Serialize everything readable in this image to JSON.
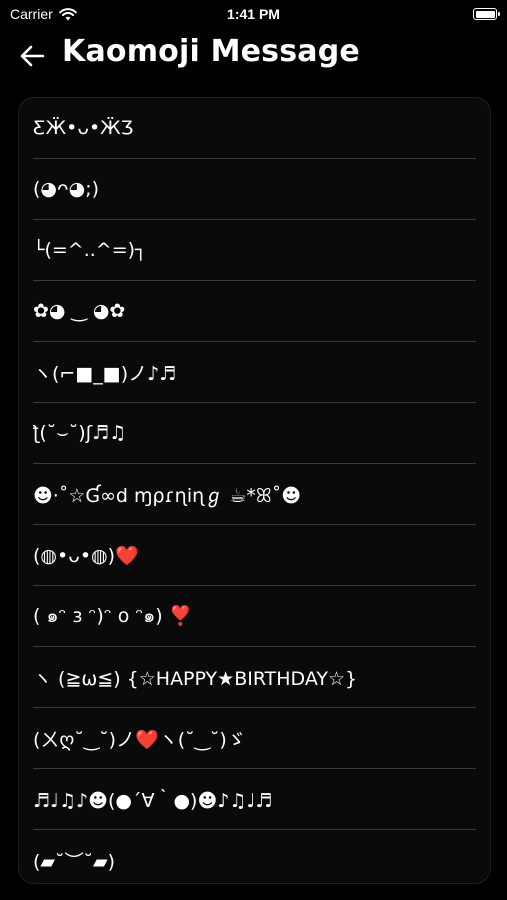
{
  "status": {
    "carrier": "Carrier",
    "time": "1:41 PM"
  },
  "header": {
    "title": "Kaomoji Message"
  },
  "items": [
    "ƸӜ•ᴗ•ӜƷ",
    "(◕ᴖ◕;)",
    "└(=^..^=)┐",
    "✿◕ ‿ ◕✿",
    "ヽ(⌐■_■)ノ♪♬",
    "ƪ(˘⌣˘)ʃ♬♫",
    "☻·˚☆Ɠ∞d ɱρɾɳiɳℊ ☕*ꕤ˚☻",
    "(◍•ᴗ•◍)❤️",
    "( ๑ᵔ з ᵔ)ᵔ о ᵔ๑) ❣️",
    "ヽ (≧ω≦) {☆HAPPY★BIRTHDAY☆}",
    "(ㄨღ˘‿˘)ノ❤️ヽ(˘‿˘)ゞ",
    "♬♩♫♪☻(●´∀｀●)☻♪♫♩♬",
    "(▰˘︶˘▰)"
  ]
}
